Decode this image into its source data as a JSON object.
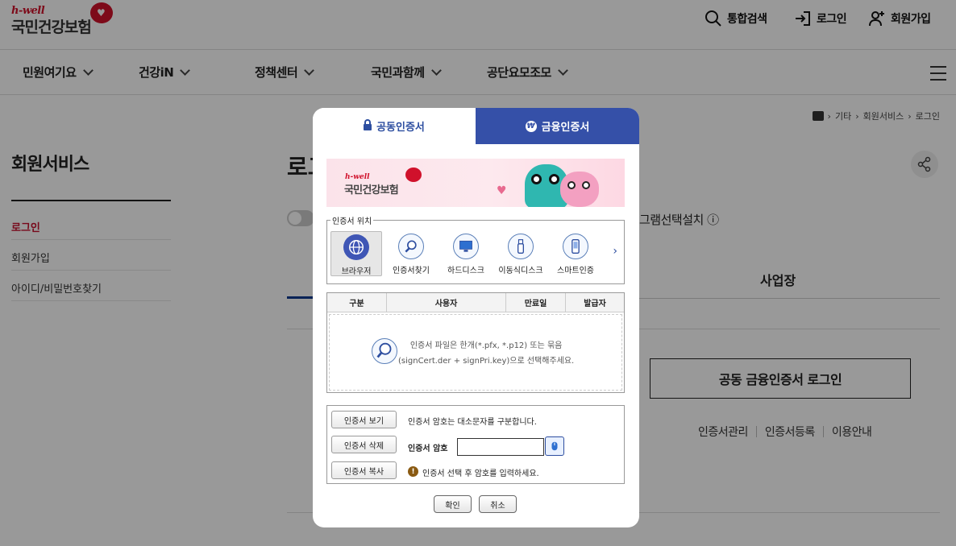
{
  "header": {
    "logo_hwell": "h-well",
    "logo_name": "국민건강보험",
    "util": {
      "search": "통합검색",
      "login": "로그인",
      "join": "회원가입"
    }
  },
  "gnb": [
    "민원여기요",
    "건강iN",
    "정책센터",
    "국민과함께",
    "공단요모조모"
  ],
  "breadcrumb": [
    "기타",
    "회원서비스",
    "로그인"
  ],
  "sidebar": {
    "title": "회원서비스",
    "items": [
      {
        "label": "로그인",
        "active": true
      },
      {
        "label": "회원가입",
        "active": false
      },
      {
        "label": "아이디/비밀번호찾기",
        "active": false
      }
    ]
  },
  "main": {
    "title_partial": "로그",
    "install_text": "그램선택설치 ⓘ",
    "tab_biz": "사업장",
    "login_button": "공동 금융인증서 로그인",
    "links": [
      "인증서관리",
      "인증서등록",
      "이용안내"
    ]
  },
  "modal": {
    "tabs": {
      "common": "공동인증서",
      "financial": "금융인증서"
    },
    "banner": {
      "hwell": "h-well",
      "name": "국민건강보험"
    },
    "location_label": "인증서 위치",
    "locations": [
      "브라우저",
      "인증서찾기",
      "하드디스크",
      "이동식디스크",
      "스마트인증"
    ],
    "table_headers": [
      "구분",
      "사용자",
      "만료일",
      "발급자"
    ],
    "table_message_line1": "인증서 파일은 한개(*.pfx, *.p12) 또는 묶음",
    "table_message_line2": "(signCert.der + signPri.key)으로 선택해주세요.",
    "buttons": {
      "view": "인증서 보기",
      "delete": "인증서 삭제",
      "copy": "인증서 복사"
    },
    "case_note": "인증서 암호는 대소문자를 구분합니다.",
    "password_label": "인증서 암호",
    "password_value": "",
    "hint": "인증서 선택 후 암호를 입력하세요.",
    "ok": "확인",
    "cancel": "취소"
  },
  "colors": {
    "brand_red": "#d0112b",
    "modal_blue": "#3550a8"
  }
}
